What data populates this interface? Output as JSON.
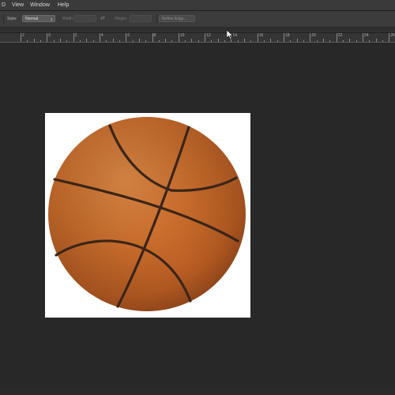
{
  "menu": {
    "items": [
      {
        "label": "D"
      },
      {
        "label": "View"
      },
      {
        "label": "Window"
      },
      {
        "label": "Help"
      }
    ]
  },
  "options": {
    "style_label": "Style:",
    "style_value": "Normal",
    "width_label": "Width:",
    "height_label": "Height:",
    "refine_button": "Refine Edge..."
  },
  "ruler": {
    "labels": [
      "2",
      "0",
      "2",
      "4",
      "6",
      "8",
      "10",
      "12",
      "14",
      "16",
      "18",
      "20",
      "22",
      "24",
      "26",
      "28",
      "30",
      "32"
    ]
  },
  "document": {
    "image": "basketball",
    "background": "#ffffff"
  },
  "colors": {
    "app_bg": "#282828",
    "menubar": "#3a3a3a",
    "optionsbar": "#3c3c3c",
    "ball_orange": "#d2722f",
    "seam": "#3a2518"
  }
}
